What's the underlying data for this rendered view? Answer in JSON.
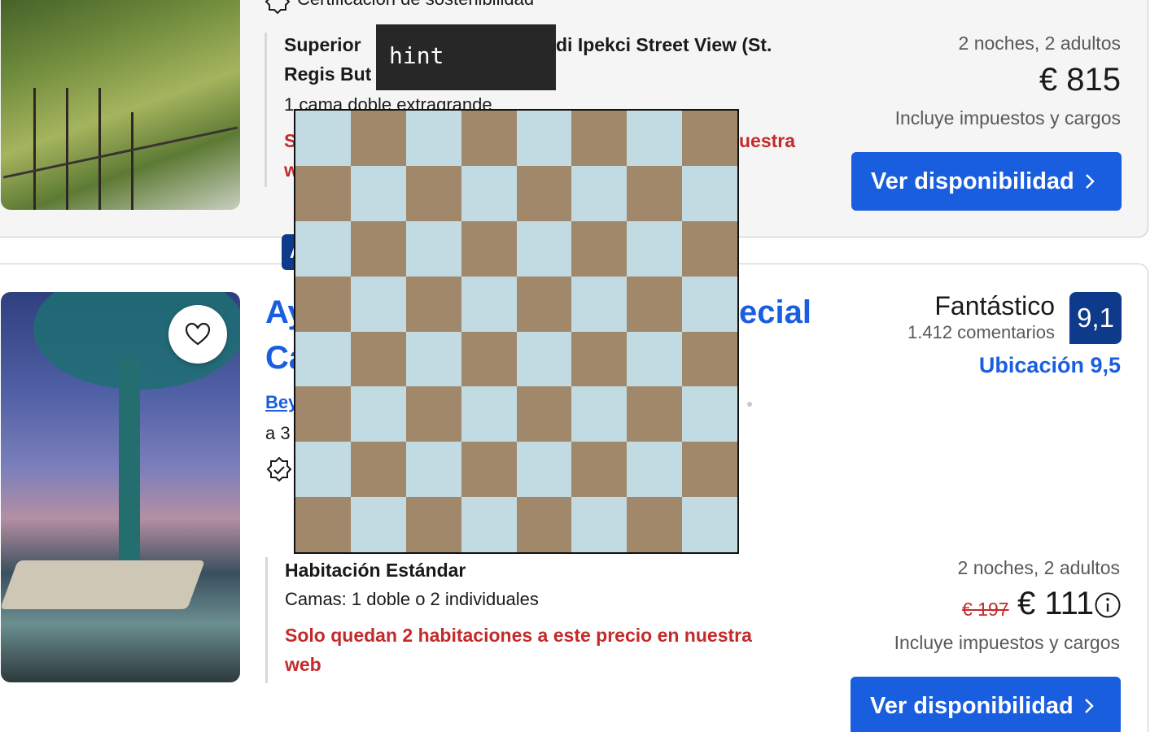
{
  "listing_1": {
    "sustainability": "Certificación de sostenibilidad",
    "room_title_line1": "Superior",
    "room_title_line1_end": "di Ipekci Street View (St.",
    "room_title_line2": "Regis But",
    "beds": "1 cama doble extragrande",
    "scarcity_start": "S",
    "scarcity_end": "uestra",
    "scarcity_line2_start": "w",
    "stay": "2 noches, 2 adultos",
    "price": "€ 815",
    "taxes": "Incluye impuestos y cargos",
    "cta": "Ver disponibilidad"
  },
  "listing_2": {
    "title_line1_start": "Ay",
    "title_line1_end": "ecial",
    "title_line2_start": "Ca",
    "district_link": "Bey",
    "distance_start": "a 3",
    "deal_chip": "Ah",
    "rating_word": "Fantástico",
    "reviews": "1.412 comentarios",
    "score": "9,1",
    "location_score": "Ubicación 9,5",
    "room_title": "Habitación Estándar",
    "beds": "Camas: 1 doble o 2 individuales",
    "scarcity": "Solo quedan 2 habitaciones a este precio en nuestra",
    "scarcity_line2": "web",
    "stay": "2 noches, 2 adultos",
    "old_price": "€ 197",
    "price": "€ 111",
    "taxes": "Incluye impuestos y cargos",
    "cta": "Ver disponibilidad"
  },
  "overlay": {
    "hint_label": "hint",
    "checker_colors": [
      "#c2dbe2",
      "#a2886b"
    ]
  }
}
